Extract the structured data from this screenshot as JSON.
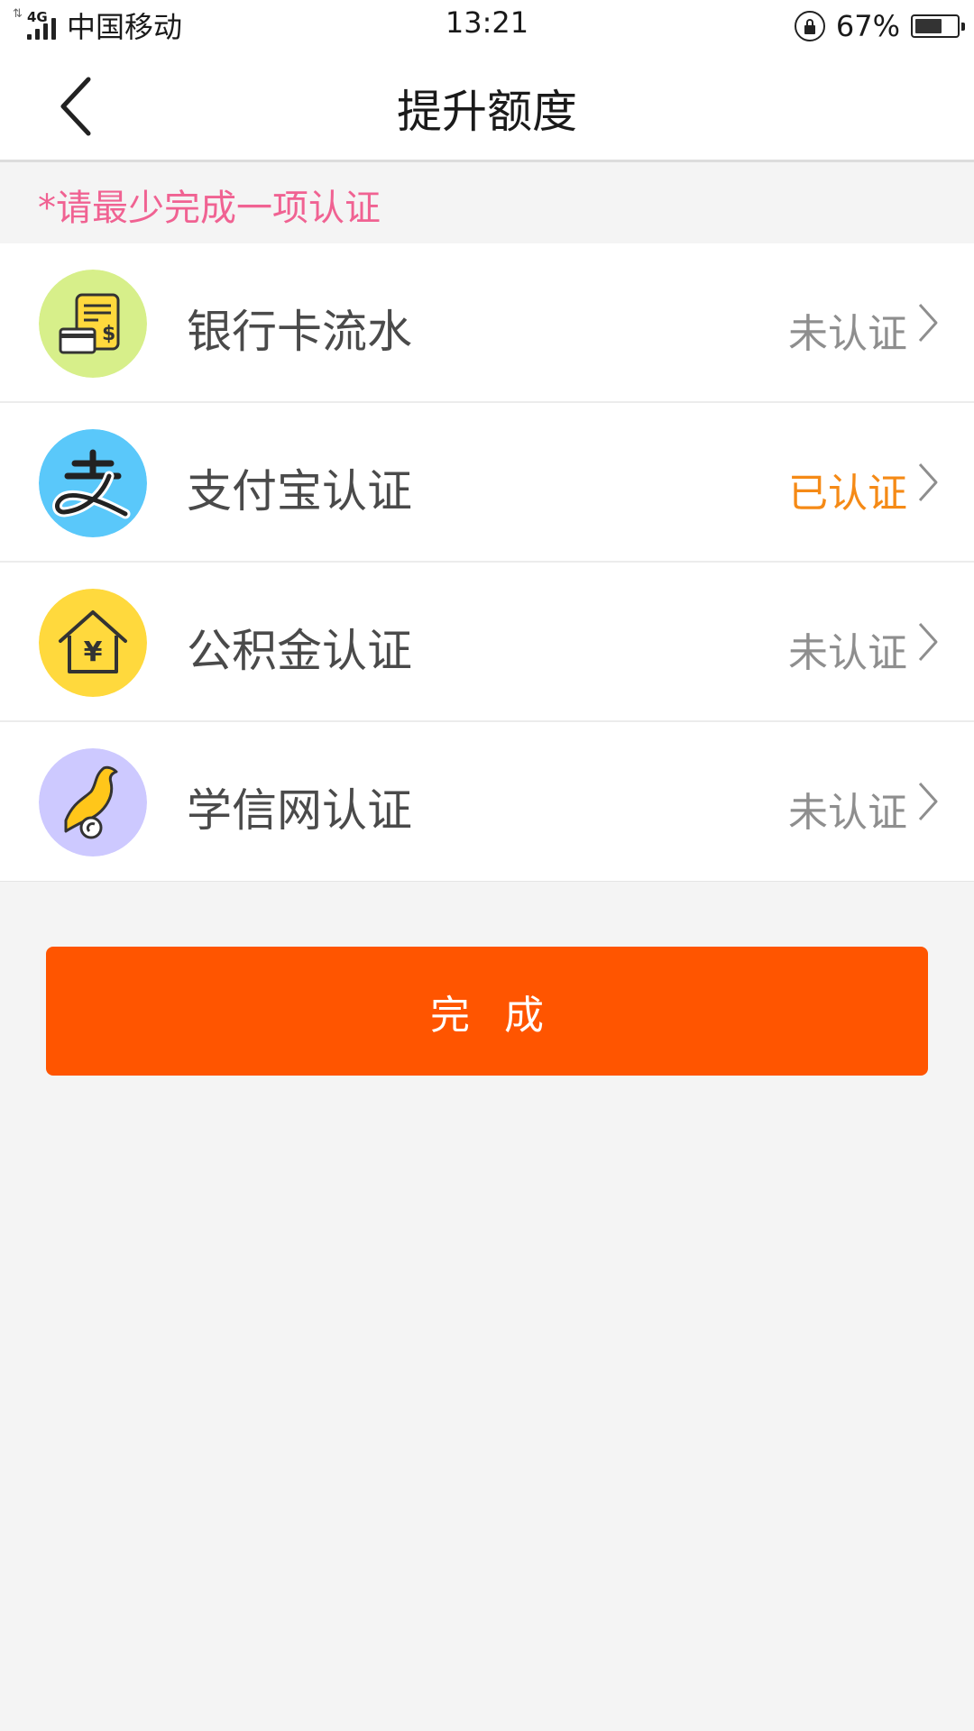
{
  "status_bar": {
    "network": "4G",
    "carrier": "中国移动",
    "time": "13:21",
    "battery_pct": "67%",
    "battery_level": 0.67
  },
  "header": {
    "title": "提升额度"
  },
  "notice": "*请最少完成一项认证",
  "items": [
    {
      "label": "银行卡流水",
      "status": "未认证",
      "icon": "bank-statement-icon",
      "icon_bg": "#d7ef8a",
      "verified": false
    },
    {
      "label": "支付宝认证",
      "status": "已认证",
      "icon": "alipay-icon",
      "icon_bg": "#5ac8fa",
      "verified": true
    },
    {
      "label": "公积金认证",
      "status": "未认证",
      "icon": "housing-fund-icon",
      "icon_bg": "#ffd93d",
      "verified": false
    },
    {
      "label": "学信网认证",
      "status": "未认证",
      "icon": "chsi-icon",
      "icon_bg": "#cdc9ff",
      "verified": false
    }
  ],
  "done_button": "完成",
  "colors": {
    "accent": "#ff5500",
    "notice": "#f06292",
    "verified": "#f58a16",
    "unverified": "#8e8e8e"
  }
}
